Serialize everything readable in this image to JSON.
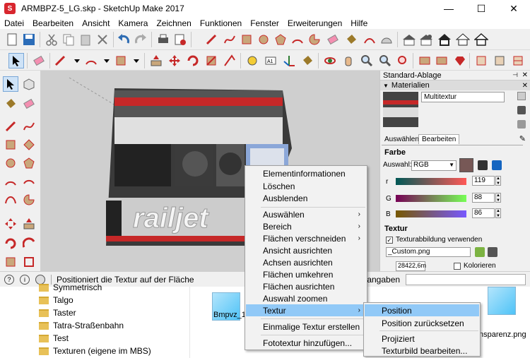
{
  "window": {
    "title": "ARMBPZ-5_LG.skp - SketchUp Make 2017",
    "minimize": "—",
    "maximize": "☐",
    "close": "✕"
  },
  "menu": [
    "Datei",
    "Bearbeiten",
    "Ansicht",
    "Kamera",
    "Zeichnen",
    "Funktionen",
    "Fenster",
    "Erweiterungen",
    "Hilfe"
  ],
  "viewport": {
    "watermark_text": "railjet"
  },
  "tray": {
    "title": "Standard-Ablage",
    "section": "Materialien",
    "material_name": "Multitextur",
    "tabs": [
      "Auswählen",
      "Bearbeiten"
    ],
    "farbe_label": "Farbe",
    "auswahl_label": "Auswahl:",
    "color_model": "RGB",
    "r_label": "r",
    "g_label": "G",
    "b_label": "B",
    "r_value": "119",
    "g_value": "88",
    "b_value": "86",
    "textur_label": "Textur",
    "use_texture_label": "Texturabbildung verwenden",
    "texture_file": "_Custom.png",
    "width_value": "28422,6m",
    "colorize_label": "Kolorieren"
  },
  "statusbar": {
    "text": "Positioniert die Textur auf der Fläche",
    "measure_label": "ßangaben"
  },
  "explorer": {
    "folders": [
      "Symmetrisch",
      "Talgo",
      "Taster",
      "Tatra-Straßenbahn",
      "Test",
      "Texturen (eigene im MBS)"
    ],
    "file_left": "Bmpvz_1_",
    "file_right": "nsparenz.png"
  },
  "context_menu": {
    "items": [
      {
        "label": "Elementinformationen",
        "submenu": false
      },
      {
        "label": "Löschen",
        "submenu": false
      },
      {
        "label": "Ausblenden",
        "submenu": false
      },
      {
        "label": "Auswählen",
        "submenu": true
      },
      {
        "label": "Bereich",
        "submenu": true
      },
      {
        "label": "Flächen verschneiden",
        "submenu": true
      },
      {
        "label": "Ansicht ausrichten",
        "submenu": false
      },
      {
        "label": "Achsen ausrichten",
        "submenu": false
      },
      {
        "label": "Flächen umkehren",
        "submenu": false
      },
      {
        "label": "Flächen ausrichten",
        "submenu": false
      },
      {
        "label": "Auswahl zoomen",
        "submenu": false
      },
      {
        "label": "Textur",
        "submenu": true
      },
      {
        "label": "Einmalige Textur erstellen",
        "submenu": false
      },
      {
        "label": "Fototextur hinzufügen...",
        "submenu": false
      }
    ],
    "submenu_arrow": "›"
  },
  "texture_submenu": {
    "items": [
      "Position",
      "Position zurücksetzen",
      "Projiziert",
      "Texturbild bearbeiten..."
    ]
  },
  "colors": {
    "accent_highlight": "#91c9f7",
    "material_swatch": "#775856",
    "menu_bg": "#f2f2f2"
  }
}
